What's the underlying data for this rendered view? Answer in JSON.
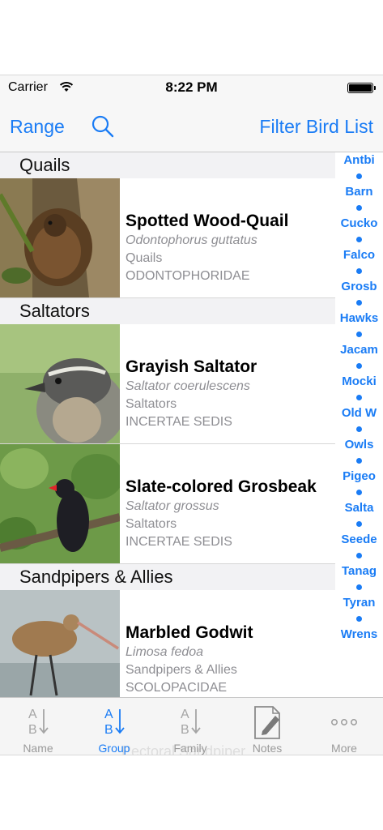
{
  "status_bar": {
    "carrier": "Carrier",
    "time": "8:22 PM"
  },
  "nav": {
    "range_label": "Range",
    "filter_label": "Filter Bird List"
  },
  "sections": [
    {
      "title": "Quails",
      "birds": [
        {
          "name": "Spotted Wood-Quail",
          "scientific": "Odontophorus guttatus",
          "group": "Quails",
          "family": "ODONTOPHORIDAE"
        }
      ]
    },
    {
      "title": "Saltators",
      "birds": [
        {
          "name": "Grayish Saltator",
          "scientific": "Saltator coerulescens",
          "group": "Saltators",
          "family": "INCERTAE SEDIS"
        },
        {
          "name": "Slate-colored Grosbeak",
          "scientific": "Saltator grossus",
          "group": "Saltators",
          "family": "INCERTAE SEDIS"
        }
      ]
    },
    {
      "title": "Sandpipers & Allies",
      "birds": [
        {
          "name": "Marbled Godwit",
          "scientific": "Limosa fedoa",
          "group": "Sandpipers & Allies",
          "family": "SCOLOPACIDAE"
        }
      ]
    }
  ],
  "index": [
    "Antbi",
    "Barn",
    "Cucko",
    "Falco",
    "Grosb",
    "Hawks",
    "Jacam",
    "Mocki",
    "Old W",
    "Owls",
    "Pigeo",
    "Salta",
    "Seede",
    "Tanag",
    "Tyran",
    "Wrens"
  ],
  "tabs": [
    {
      "label": "Name",
      "active": false
    },
    {
      "label": "Group",
      "active": true
    },
    {
      "label": "Family",
      "active": false
    },
    {
      "label": "Notes",
      "active": false
    },
    {
      "label": "More",
      "active": false
    }
  ],
  "ghost_text": "Pectoral Sandpiper",
  "colors": {
    "accent": "#1a7cf5",
    "secondary_text": "#8e8e93"
  }
}
